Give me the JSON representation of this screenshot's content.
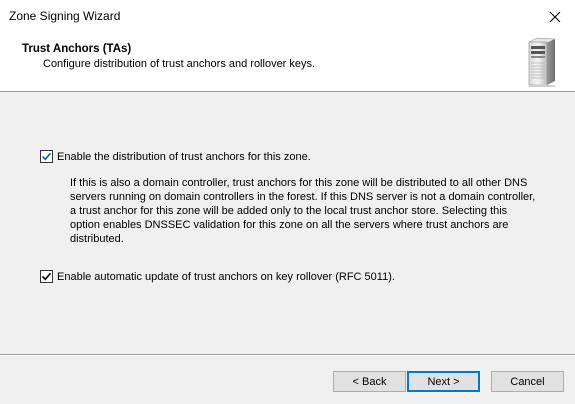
{
  "window": {
    "title": "Zone Signing Wizard"
  },
  "header": {
    "title": "Trust Anchors (TAs)",
    "subtitle": "Configure distribution of trust anchors and rollover keys."
  },
  "options": {
    "enable_distribution": {
      "label": "Enable the distribution of trust anchors for this zone.",
      "checked": true
    },
    "description_lines": [
      "If this is also a domain controller, trust anchors for this zone will be distributed to all other DNS",
      "servers running on domain controllers in the forest. If this DNS server is not a domain controller,",
      "a trust anchor for this zone will be added only to the local trust anchor store. Selecting this",
      "option enables DNSSEC validation for this zone on all the servers where trust anchors are",
      "distributed."
    ],
    "auto_update": {
      "label": "Enable automatic update of trust anchors on key rollover (RFC 5011).",
      "checked": true
    }
  },
  "buttons": {
    "back": "< Back",
    "next": "Next >",
    "cancel": "Cancel"
  },
  "colors": {
    "accent": "#0078d7",
    "dialog_bg": "#f0f0f0",
    "header_bg": "#ffffff"
  },
  "icons": {
    "close": "close-icon",
    "header": "server-icon",
    "checkmark": "checkmark-icon"
  }
}
